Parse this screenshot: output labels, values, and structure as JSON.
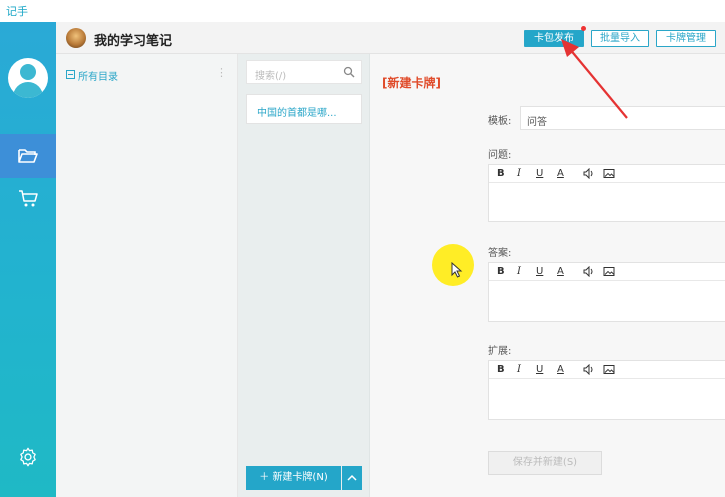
{
  "app": {
    "logo_text": "记手"
  },
  "header": {
    "title": "我的学习笔记",
    "publish_label": "卡包发布",
    "import_label": "批量导入",
    "manage_label": "卡牌管理"
  },
  "sidebar": {
    "items": [
      {
        "icon": "folder-open-icon",
        "active": true
      },
      {
        "icon": "cart-icon",
        "active": false
      }
    ],
    "settings_icon": "gear-icon"
  },
  "directory": {
    "root_label": "所有目录"
  },
  "card_list": {
    "search_placeholder": "搜索(/)",
    "items": [
      {
        "label": "中国的首都是哪..."
      }
    ],
    "new_card_label": "新建卡牌(N)"
  },
  "editor": {
    "title": "[新建卡牌]",
    "template_label": "模板:",
    "template_value": "问答",
    "fields": [
      {
        "label": "问题:"
      },
      {
        "label": "答案:"
      },
      {
        "label": "扩展:"
      }
    ],
    "toolbar": {
      "bold": "B",
      "italic": "I",
      "underline": "U",
      "color": "A"
    },
    "save_label": "保存并新建(S)"
  },
  "colors": {
    "accent": "#24a6c9",
    "rail_top": "#2aa9d6",
    "rail_bottom": "#1fb9c5",
    "title_red": "#e04b2a",
    "annotation_arrow": "#e53333",
    "cursor_highlight": "#ffec14"
  }
}
